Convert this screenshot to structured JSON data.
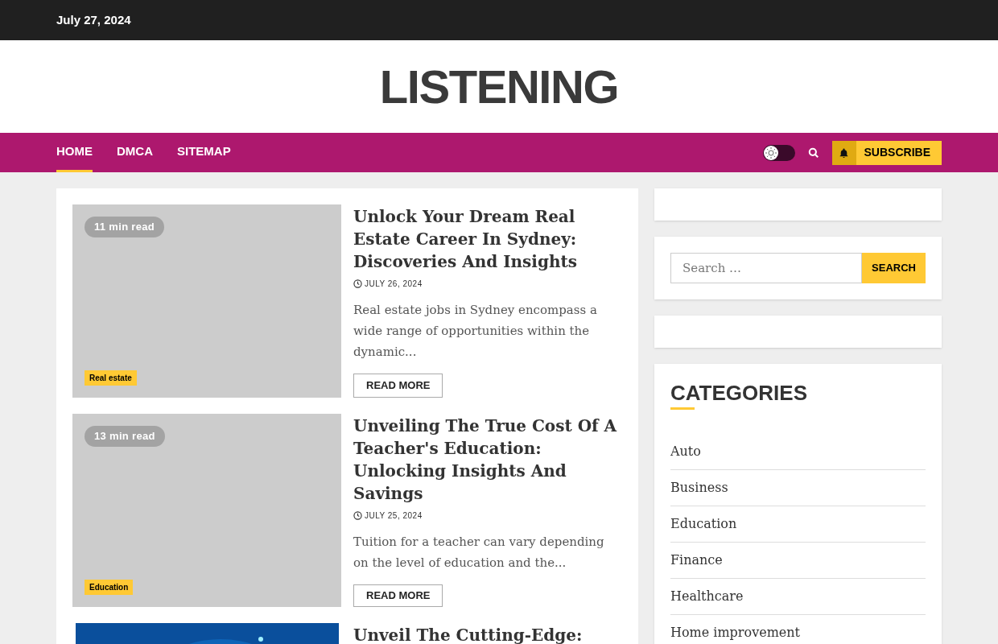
{
  "top_bar": {
    "date": "July 27, 2024"
  },
  "site_title": "LISTENING",
  "nav": {
    "items": [
      {
        "label": "HOME",
        "selected": true
      },
      {
        "label": "DMCA",
        "selected": false
      },
      {
        "label": "SITEMAP",
        "selected": false
      }
    ],
    "dark_mode": false,
    "subscribe": "SUBSCRIBE"
  },
  "articles": [
    {
      "kind": "placeholder",
      "read_time": "11 min read",
      "category": "Real estate",
      "title": "Unlock Your Dream Real Estate Career In Sydney: Discoveries And Insights",
      "date": "JULY 26, 2024",
      "excerpt": "Real estate jobs in Sydney encompass a wide range of opportunities within the dynamic...",
      "button": "READ MORE"
    },
    {
      "kind": "placeholder",
      "read_time": "13 min read",
      "category": "Education",
      "title": "Unveiling The True Cost Of A Teacher's Education: Unlocking Insights And Savings",
      "date": "JULY 25, 2024",
      "excerpt": "Tuition for a teacher can vary depending on the level of education and the...",
      "button": "READ MORE"
    },
    {
      "kind": "picture",
      "title": "Unveil The Cutting-Edge:"
    }
  ],
  "sidebar": {
    "search": {
      "placeholder": "Search …",
      "button": "SEARCH"
    },
    "categories": {
      "heading": "CATEGORIES",
      "items": [
        "Auto",
        "Business",
        "Education",
        "Finance",
        "Healthcare",
        "Home improvement"
      ]
    }
  }
}
